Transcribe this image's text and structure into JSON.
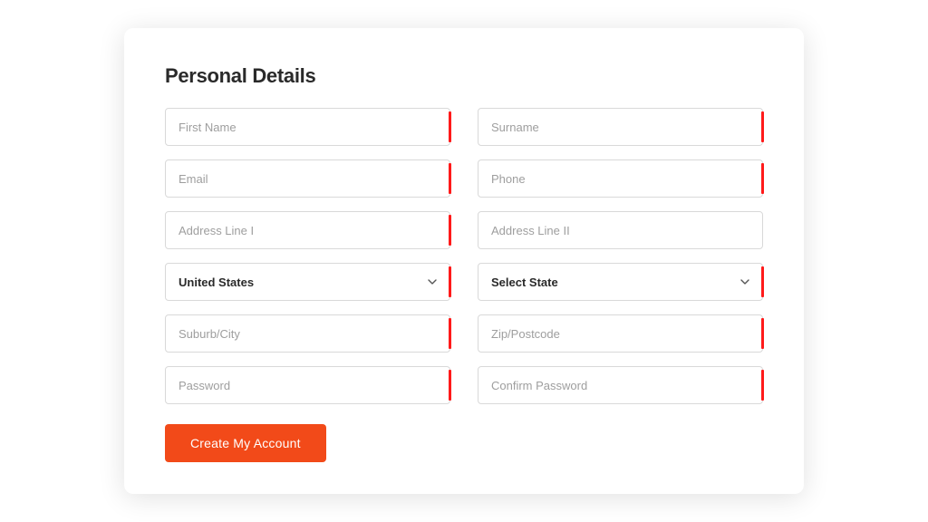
{
  "heading": "Personal Details",
  "fields": {
    "first_name": {
      "placeholder": "First Name",
      "value": ""
    },
    "surname": {
      "placeholder": "Surname",
      "value": ""
    },
    "email": {
      "placeholder": "Email",
      "value": ""
    },
    "phone": {
      "placeholder": "Phone",
      "value": ""
    },
    "address1": {
      "placeholder": "Address Line I",
      "value": ""
    },
    "address2": {
      "placeholder": "Address Line II",
      "value": ""
    },
    "country": {
      "selected": "United States"
    },
    "state": {
      "selected": "Select State"
    },
    "suburb_city": {
      "placeholder": "Suburb/City",
      "value": ""
    },
    "zip": {
      "placeholder": "Zip/Postcode",
      "value": ""
    },
    "password": {
      "placeholder": "Password",
      "value": ""
    },
    "confirm_password": {
      "placeholder": "Confirm Password",
      "value": ""
    }
  },
  "submit_label": "Create My Account"
}
